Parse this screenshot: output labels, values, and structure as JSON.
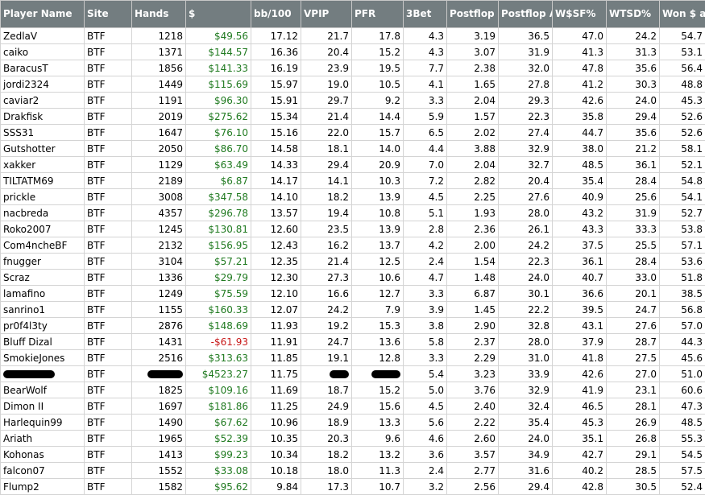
{
  "columns": [
    "Player Name",
    "Site",
    "Hands",
    "$",
    "bb/100",
    "VPIP",
    "PFR",
    "3Bet",
    "Postflop Agg",
    "Postflop Agg%",
    "W$SF%",
    "WTSD%",
    "Won $ at SD"
  ],
  "rows": [
    [
      "ZedlaV",
      "BTF",
      "1218",
      "$49.56",
      "17.12",
      "21.7",
      "17.8",
      "4.3",
      "3.19",
      "36.5",
      "47.0",
      "24.2",
      "54.7"
    ],
    [
      "caiko",
      "BTF",
      "1371",
      "$144.57",
      "16.36",
      "20.4",
      "15.2",
      "4.3",
      "3.07",
      "31.9",
      "41.3",
      "31.3",
      "53.1"
    ],
    [
      "BaracusT",
      "BTF",
      "1856",
      "$141.33",
      "16.19",
      "23.9",
      "19.5",
      "7.7",
      "2.38",
      "32.0",
      "47.8",
      "35.6",
      "56.4"
    ],
    [
      "jordi2324",
      "BTF",
      "1449",
      "$115.69",
      "15.97",
      "19.0",
      "10.5",
      "4.1",
      "1.65",
      "27.8",
      "41.2",
      "30.3",
      "48.8"
    ],
    [
      "caviar2",
      "BTF",
      "1191",
      "$96.30",
      "15.91",
      "29.7",
      "9.2",
      "3.3",
      "2.04",
      "29.3",
      "42.6",
      "24.0",
      "45.3"
    ],
    [
      "Drakfisk",
      "BTF",
      "2019",
      "$275.62",
      "15.34",
      "21.4",
      "14.4",
      "5.9",
      "1.57",
      "22.3",
      "35.8",
      "29.4",
      "52.6"
    ],
    [
      "SSS31",
      "BTF",
      "1647",
      "$76.10",
      "15.16",
      "22.0",
      "15.7",
      "6.5",
      "2.02",
      "27.4",
      "44.7",
      "35.6",
      "52.6"
    ],
    [
      "Gutshotter",
      "BTF",
      "2050",
      "$86.70",
      "14.58",
      "18.1",
      "14.0",
      "4.4",
      "3.88",
      "32.9",
      "38.0",
      "21.2",
      "58.1"
    ],
    [
      "xakker",
      "BTF",
      "1129",
      "$63.49",
      "14.33",
      "29.4",
      "20.9",
      "7.0",
      "2.04",
      "32.7",
      "48.5",
      "36.1",
      "52.1"
    ],
    [
      "TILTATM69",
      "BTF",
      "2189",
      "$6.87",
      "14.17",
      "14.1",
      "10.3",
      "7.2",
      "2.82",
      "20.4",
      "35.4",
      "28.4",
      "54.8"
    ],
    [
      "prickle",
      "BTF",
      "3008",
      "$347.58",
      "14.10",
      "18.2",
      "13.9",
      "4.5",
      "2.25",
      "27.6",
      "40.9",
      "25.6",
      "54.1"
    ],
    [
      "nacbreda",
      "BTF",
      "4357",
      "$296.78",
      "13.57",
      "19.4",
      "10.8",
      "5.1",
      "1.93",
      "28.0",
      "43.2",
      "31.9",
      "52.7"
    ],
    [
      "Roko2007",
      "BTF",
      "1245",
      "$130.81",
      "12.60",
      "23.5",
      "13.9",
      "2.8",
      "2.36",
      "26.1",
      "43.3",
      "33.3",
      "53.8"
    ],
    [
      "Com4ncheBF",
      "BTF",
      "2132",
      "$156.95",
      "12.43",
      "16.2",
      "13.7",
      "4.2",
      "2.00",
      "24.2",
      "37.5",
      "25.5",
      "57.1"
    ],
    [
      "fnugger",
      "BTF",
      "3104",
      "$57.21",
      "12.35",
      "21.4",
      "12.5",
      "2.4",
      "1.54",
      "22.3",
      "36.1",
      "28.4",
      "53.6"
    ],
    [
      "Scraz",
      "BTF",
      "1336",
      "$29.79",
      "12.30",
      "27.3",
      "10.6",
      "4.7",
      "1.48",
      "24.0",
      "40.7",
      "33.0",
      "51.8"
    ],
    [
      "lamafino",
      "BTF",
      "1249",
      "$75.59",
      "12.10",
      "16.6",
      "12.7",
      "3.3",
      "6.87",
      "30.1",
      "36.6",
      "20.1",
      "38.5"
    ],
    [
      "sanrino1",
      "BTF",
      "1155",
      "$160.33",
      "12.07",
      "24.2",
      "7.9",
      "3.9",
      "1.45",
      "22.2",
      "39.5",
      "24.7",
      "56.8"
    ],
    [
      "pr0f4l3ty",
      "BTF",
      "2876",
      "$148.69",
      "11.93",
      "19.2",
      "15.3",
      "3.8",
      "2.90",
      "32.8",
      "43.1",
      "27.6",
      "57.0"
    ],
    [
      "Bluff Dizal",
      "BTF",
      "1431",
      "-$61.93",
      "11.91",
      "24.7",
      "13.6",
      "5.8",
      "2.37",
      "28.0",
      "37.9",
      "28.7",
      "44.3"
    ],
    [
      "SmokieJones",
      "BTF",
      "2516",
      "$313.63",
      "11.85",
      "19.1",
      "12.8",
      "3.3",
      "2.29",
      "31.0",
      "41.8",
      "27.5",
      "45.6"
    ],
    [
      "",
      "BTF",
      "",
      "$4523.27",
      "11.75",
      "",
      "",
      "5.4",
      "3.23",
      "33.9",
      "42.6",
      "27.0",
      "51.0"
    ],
    [
      "BearWolf",
      "BTF",
      "1825",
      "$109.16",
      "11.69",
      "18.7",
      "15.2",
      "5.0",
      "3.76",
      "32.9",
      "41.9",
      "23.1",
      "60.6"
    ],
    [
      "Dimon II",
      "BTF",
      "1697",
      "$181.86",
      "11.25",
      "24.9",
      "15.6",
      "4.5",
      "2.40",
      "32.4",
      "46.5",
      "28.1",
      "47.3"
    ],
    [
      "Harlequin99",
      "BTF",
      "1490",
      "$67.62",
      "10.96",
      "18.9",
      "13.3",
      "5.6",
      "2.22",
      "35.4",
      "45.3",
      "26.9",
      "48.5"
    ],
    [
      "Ariath",
      "BTF",
      "1965",
      "$52.39",
      "10.35",
      "20.3",
      "9.6",
      "4.6",
      "2.60",
      "24.0",
      "35.1",
      "26.8",
      "55.3"
    ],
    [
      "Kohonas",
      "BTF",
      "1413",
      "$99.23",
      "10.34",
      "18.2",
      "13.2",
      "3.6",
      "3.57",
      "34.9",
      "42.7",
      "29.1",
      "54.5"
    ],
    [
      "falcon07",
      "BTF",
      "1552",
      "$33.08",
      "10.18",
      "18.0",
      "11.3",
      "2.4",
      "2.77",
      "31.6",
      "40.2",
      "28.5",
      "57.5"
    ],
    [
      "Flump2",
      "BTF",
      "1582",
      "$95.62",
      "9.84",
      "17.3",
      "10.7",
      "3.2",
      "2.56",
      "29.4",
      "42.8",
      "30.5",
      "52.4"
    ]
  ],
  "colors": {
    "header_bg": "#737d80",
    "positive_money": "#207a20",
    "negative_money": "#c81818"
  }
}
